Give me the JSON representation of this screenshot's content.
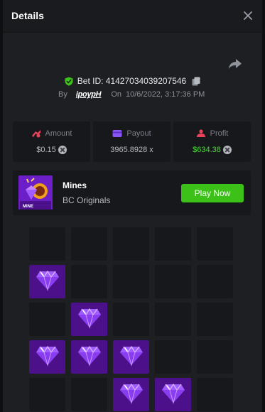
{
  "header": {
    "title": "Details"
  },
  "bet": {
    "id_label": "Bet ID: 41427034039207546",
    "by_label": "By",
    "user": "ipoypH",
    "on_label": "On",
    "date": "10/6/2022, 3:17:36 PM"
  },
  "stats": {
    "amount": {
      "label": "Amount",
      "value": "$0.15"
    },
    "payout": {
      "label": "Payout",
      "value": "3965.8928 x"
    },
    "profit": {
      "label": "Profit",
      "value": "$634.38"
    }
  },
  "game": {
    "name": "Mines",
    "provider": "BC Originals",
    "thumb_caption": "MINE",
    "play_label": "Play Now"
  },
  "board": {
    "rows": 5,
    "cols": 5,
    "cells": [
      [
        0,
        0,
        0,
        0,
        0
      ],
      [
        1,
        0,
        0,
        0,
        0
      ],
      [
        0,
        1,
        0,
        0,
        0
      ],
      [
        1,
        1,
        1,
        0,
        0
      ],
      [
        0,
        0,
        1,
        1,
        0
      ]
    ]
  },
  "colors": {
    "accent_green": "#3bc117",
    "profit_green": "#4ddb3a",
    "gem_tile": "#4c108a",
    "gem": "#a15cff"
  },
  "icons": {
    "close": "close-icon",
    "share": "share-icon",
    "shield": "shield-check-icon",
    "copy": "copy-icon",
    "amount": "coins-icon",
    "payout": "wallet-icon",
    "profit": "profit-icon",
    "coin": "coin-icon",
    "gem": "gem-icon"
  }
}
